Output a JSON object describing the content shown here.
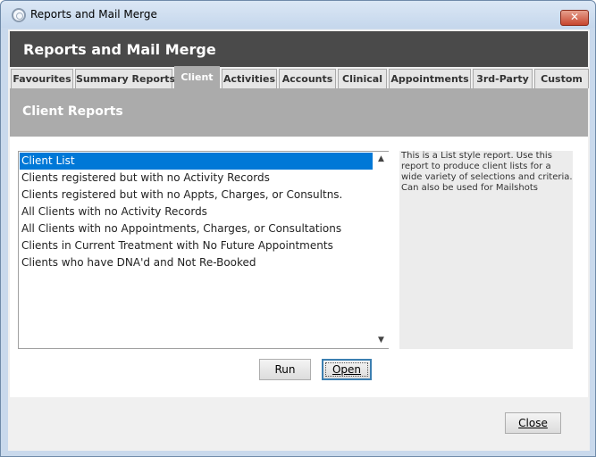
{
  "window": {
    "title": "Reports and Mail Merge",
    "close_glyph": "✕"
  },
  "header": {
    "title": "Reports and Mail Merge"
  },
  "tabs": [
    {
      "label": "Favourites"
    },
    {
      "label": "Summary Reports"
    },
    {
      "label": "Client"
    },
    {
      "label": "Activities"
    },
    {
      "label": "Accounts"
    },
    {
      "label": "Clinical"
    },
    {
      "label": "Appointments"
    },
    {
      "label": "3rd-Party"
    },
    {
      "label": "Custom"
    }
  ],
  "active_tab": "Client",
  "section": {
    "title": "Client Reports"
  },
  "reports": {
    "items": [
      "Client List",
      "Clients registered but with no Activity Records",
      "Clients registered but with no Appts, Charges, or Consultns.",
      "All Clients with no Activity Records",
      "All Clients with no Appointments, Charges, or Consultations",
      "Clients in Current Treatment with No Future Appointments",
      "Clients who have DNA'd and Not Re-Booked"
    ],
    "selected": "Client List"
  },
  "description": {
    "text": "This is a List style report. Use this report to produce client lists for a wide variety of selections and criteria. Can also be used for Mailshots"
  },
  "buttons": {
    "run": "Run",
    "open": "Open",
    "close": "Close"
  },
  "colors": {
    "header_bg": "#4a4a4a",
    "section_bg": "#ababab",
    "selection": "#0078d7"
  }
}
